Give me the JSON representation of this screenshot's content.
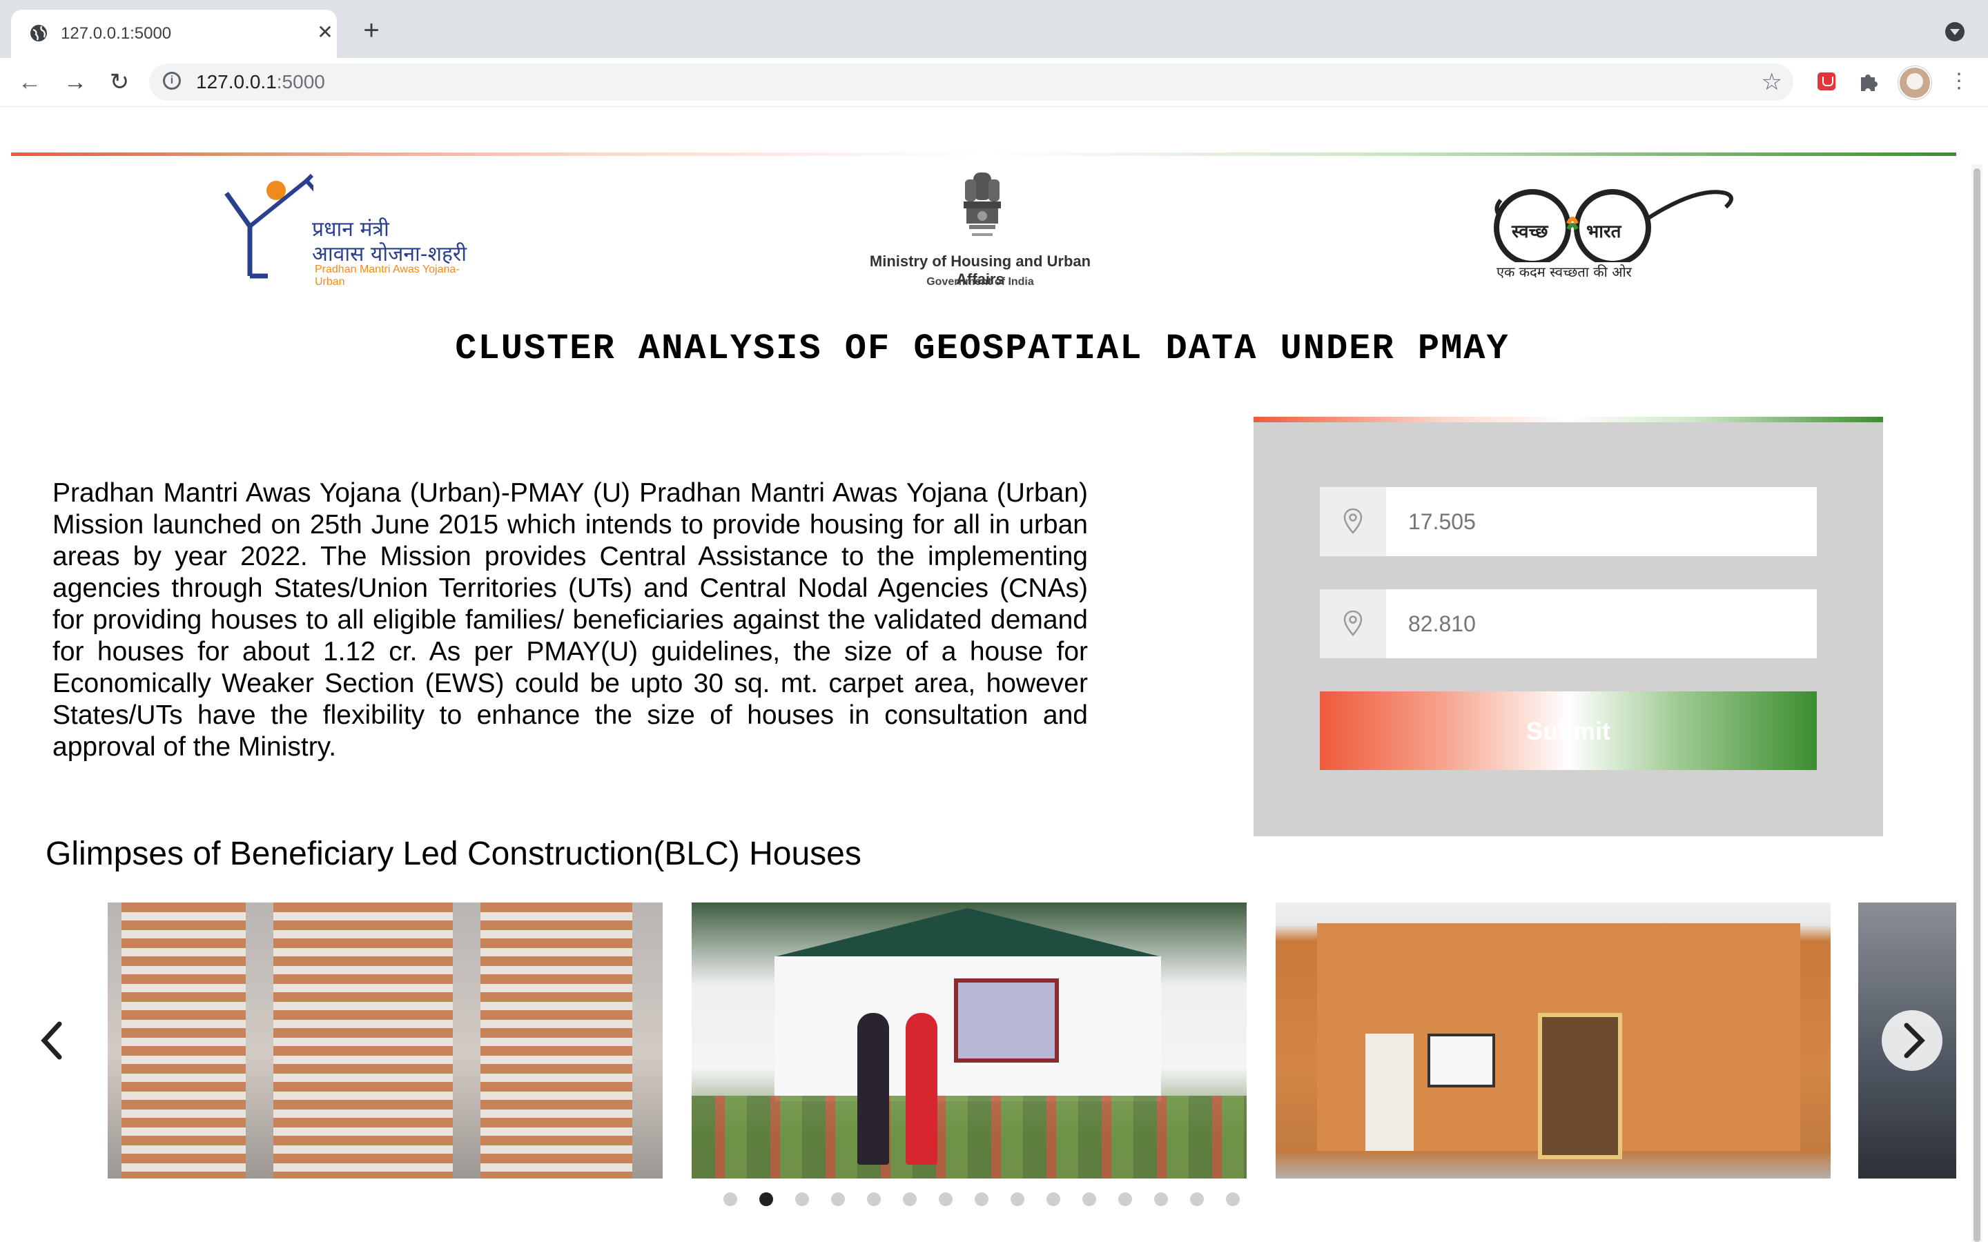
{
  "browser": {
    "tab_title": "127.0.0.1:5000",
    "url_host": "127.0.0.1",
    "url_port": ":5000",
    "icons": [
      "globe-icon",
      "close-icon",
      "plus-icon",
      "tab-search-icon",
      "back-icon",
      "forward-icon",
      "reload-icon",
      "info-icon",
      "star-icon",
      "extension-red-icon",
      "puzzle-icon",
      "avatar",
      "more-vert-icon"
    ]
  },
  "logos": {
    "pmay": {
      "line1": "प्रधान मंत्री",
      "line2": "आवास योजना-शहरी",
      "line3": "Pradhan Mantri Awas Yojana-Urban"
    },
    "mohua": {
      "line1": "Ministry of Housing and Urban Affairs",
      "line2": "Government of India"
    },
    "swachh": {
      "word1": "स्वच्छ",
      "word2": "भारत",
      "tagline": "एक कदम स्वच्छता की ओर"
    }
  },
  "page": {
    "title": "CLUSTER ANALYSIS OF GEOSPATIAL DATA UNDER PMAY",
    "intro": "Pradhan Mantri Awas Yojana (Urban)-PMAY (U) Pradhan Mantri Awas Yojana (Urban) Mission launched on 25th June 2015 which intends to provide housing for all in urban areas by year 2022. The Mission provides Central Assistance to the implementing agencies through States/Union Territories (UTs) and Central Nodal Agencies (CNAs) for providing houses to all eligible families/ beneficiaries against the validated demand for houses for about 1.12 cr. As per PMAY(U) guidelines, the size of a house for Economically Weaker Section (EWS) could be upto 30 sq. mt. carpet area, however States/UTs have the flexibility to enhance the size of houses in consultation and approval of the Ministry."
  },
  "form": {
    "latitude_placeholder": "17.505",
    "longitude_placeholder": "82.810",
    "submit_label": "Submit"
  },
  "gallery": {
    "title": "Glimpses of Beneficiary Led Construction(BLC) Houses",
    "dot_count": 15,
    "active_dot": 2
  },
  "colors": {
    "saffron": "#f05a3b",
    "green": "#3c8d2f",
    "form_bg": "#d1d1d1"
  }
}
